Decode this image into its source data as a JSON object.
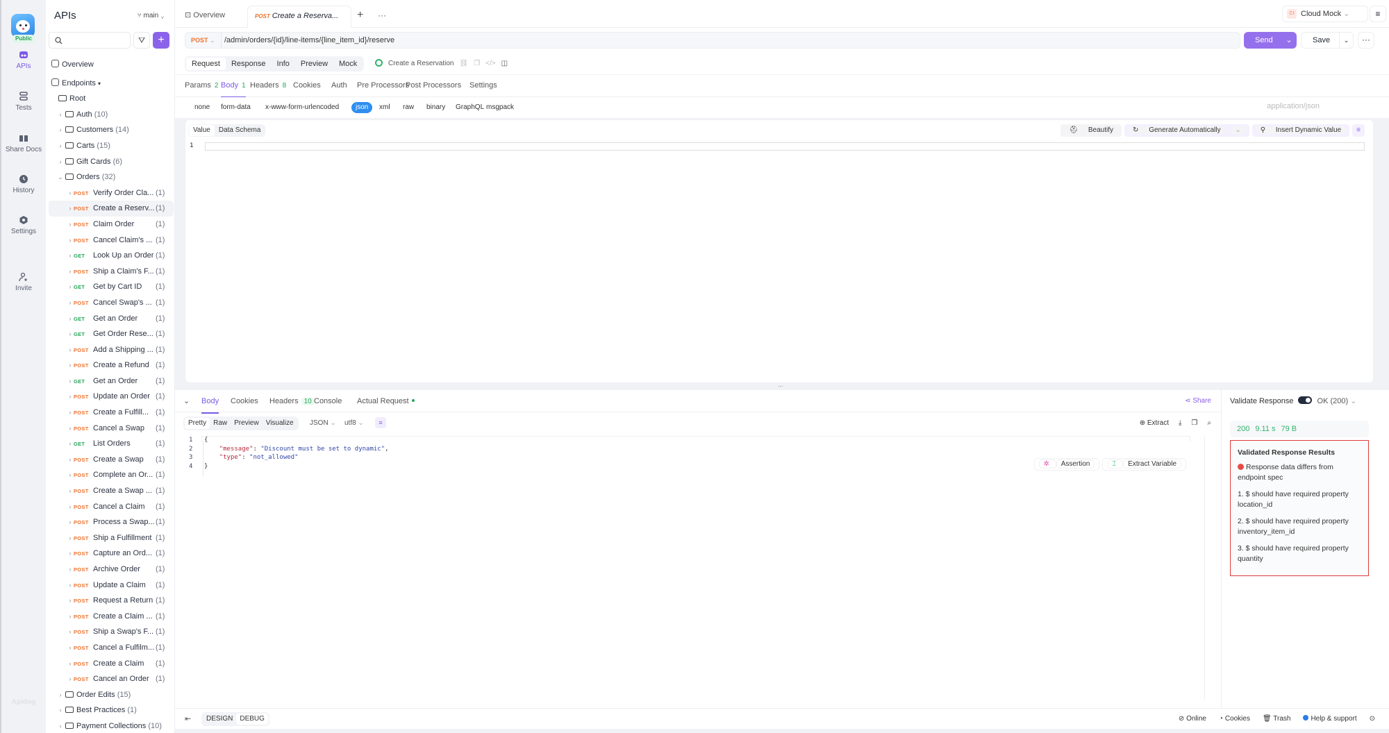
{
  "rail": {
    "badge": "Public",
    "items": [
      {
        "label": "APIs",
        "icon": "apis-icon",
        "active": true
      },
      {
        "label": "Tests",
        "icon": "tests-icon"
      },
      {
        "label": "Share Docs",
        "icon": "book-icon"
      },
      {
        "label": "History",
        "icon": "clock-icon"
      },
      {
        "label": "Settings",
        "icon": "gear-icon"
      },
      {
        "label": "Invite",
        "icon": "user-plus-icon"
      }
    ],
    "brand": "Apidog"
  },
  "sidebar": {
    "title": "APIs",
    "branch": "main",
    "search_placeholder": "",
    "overview": "Overview",
    "endpoints": "Endpoints",
    "root": "Root",
    "folders_top": [
      {
        "name": "Auth",
        "count": "(10)"
      },
      {
        "name": "Customers",
        "count": "(14)"
      },
      {
        "name": "Carts",
        "count": "(15)"
      },
      {
        "name": "Gift Cards",
        "count": "(6)"
      }
    ],
    "orders": {
      "name": "Orders",
      "count": "(32)"
    },
    "requests": [
      {
        "method": "POST",
        "name": "Verify Order Cla...",
        "count": "(1)"
      },
      {
        "method": "POST",
        "name": "Create a Reserv...",
        "count": "(1)",
        "selected": true
      },
      {
        "method": "POST",
        "name": "Claim Order",
        "count": "(1)"
      },
      {
        "method": "POST",
        "name": "Cancel Claim's ...",
        "count": "(1)"
      },
      {
        "method": "GET",
        "name": "Look Up an Order",
        "count": "(1)"
      },
      {
        "method": "POST",
        "name": "Ship a Claim's F...",
        "count": "(1)"
      },
      {
        "method": "GET",
        "name": "Get by Cart ID",
        "count": "(1)"
      },
      {
        "method": "POST",
        "name": "Cancel Swap's ...",
        "count": "(1)"
      },
      {
        "method": "GET",
        "name": "Get an Order",
        "count": "(1)"
      },
      {
        "method": "GET",
        "name": "Get Order Rese...",
        "count": "(1)"
      },
      {
        "method": "POST",
        "name": "Add a Shipping ...",
        "count": "(1)"
      },
      {
        "method": "POST",
        "name": "Create a Refund",
        "count": "(1)"
      },
      {
        "method": "GET",
        "name": "Get an Order",
        "count": "(1)"
      },
      {
        "method": "POST",
        "name": "Update an Order",
        "count": "(1)"
      },
      {
        "method": "POST",
        "name": "Create a Fulfill...",
        "count": "(1)"
      },
      {
        "method": "POST",
        "name": "Cancel a Swap",
        "count": "(1)"
      },
      {
        "method": "GET",
        "name": "List Orders",
        "count": "(1)"
      },
      {
        "method": "POST",
        "name": "Create a Swap",
        "count": "(1)"
      },
      {
        "method": "POST",
        "name": "Complete an Or...",
        "count": "(1)"
      },
      {
        "method": "POST",
        "name": "Create a Swap ...",
        "count": "(1)"
      },
      {
        "method": "POST",
        "name": "Cancel a Claim",
        "count": "(1)"
      },
      {
        "method": "POST",
        "name": "Process a Swap...",
        "count": "(1)"
      },
      {
        "method": "POST",
        "name": "Ship a Fulfillment",
        "count": "(1)"
      },
      {
        "method": "POST",
        "name": "Capture an Ord...",
        "count": "(1)"
      },
      {
        "method": "POST",
        "name": "Archive Order",
        "count": "(1)"
      },
      {
        "method": "POST",
        "name": "Update a Claim",
        "count": "(1)"
      },
      {
        "method": "POST",
        "name": "Request a Return",
        "count": "(1)"
      },
      {
        "method": "POST",
        "name": "Create a Claim ...",
        "count": "(1)"
      },
      {
        "method": "POST",
        "name": "Ship a Swap's F...",
        "count": "(1)"
      },
      {
        "method": "POST",
        "name": "Cancel a Fulfilm...",
        "count": "(1)"
      },
      {
        "method": "POST",
        "name": "Create a Claim",
        "count": "(1)"
      },
      {
        "method": "POST",
        "name": "Cancel an Order",
        "count": "(1)"
      }
    ],
    "folders_bottom": [
      {
        "name": "Order Edits",
        "count": "(15)"
      },
      {
        "name": "Best Practices",
        "count": "(1)"
      },
      {
        "name": "Payment Collections",
        "count": "(10)"
      }
    ]
  },
  "tabs": {
    "overview": "Overview",
    "active_method": "POST",
    "active_title": "Create a Reserva...",
    "add": "+",
    "more": "···"
  },
  "environment": {
    "badge": "CI",
    "label": "Cloud Mock"
  },
  "request": {
    "method": "POST",
    "url": "/admin/orders/{id}/line-items/{line_item_id}/reserve",
    "send": "Send",
    "save": "Save",
    "modes": [
      "Request",
      "Response",
      "Info",
      "Preview",
      "Mock"
    ],
    "active_mode": "Request",
    "endpoint_name": "Create a Reservation",
    "subtabs": [
      {
        "label": "Params",
        "count": "2"
      },
      {
        "label": "Body",
        "count": "1",
        "active": true
      },
      {
        "label": "Headers",
        "count": "8"
      },
      {
        "label": "Cookies"
      },
      {
        "label": "Auth"
      },
      {
        "label": "Pre Processors"
      },
      {
        "label": "Post Processors"
      },
      {
        "label": "Settings"
      }
    ],
    "body_types": [
      "none",
      "form-data",
      "x-www-form-urlencoded",
      "json",
      "xml",
      "raw",
      "binary",
      "GraphQL",
      "msgpack"
    ],
    "active_body_type": "json",
    "content_type": "application/json",
    "editor_tabs": [
      "Value",
      "Data Schema"
    ],
    "editor_tools": {
      "beautify": "Beautify",
      "generate": "Generate Automatically",
      "insert": "Insert Dynamic Value"
    },
    "line_number": "1"
  },
  "response": {
    "tabs": [
      {
        "label": "Body",
        "active": true
      },
      {
        "label": "Cookies"
      },
      {
        "label": "Headers",
        "count": "10"
      },
      {
        "label": "Console"
      },
      {
        "label": "Actual Request",
        "dot": true
      }
    ],
    "share": "Share",
    "views": [
      "Pretty",
      "Raw",
      "Preview",
      "Visualize"
    ],
    "active_view": "Pretty",
    "format": "JSON",
    "encoding": "utf8",
    "extract": "Extract",
    "code_lines": [
      {
        "n": "1",
        "text": "{"
      },
      {
        "n": "2",
        "key": "\"message\"",
        "value": "\"Discount must be set to dynamic\"",
        "trail": ","
      },
      {
        "n": "3",
        "key": "\"type\"",
        "value": "\"not_allowed\"",
        "trail": ""
      },
      {
        "n": "4",
        "text": "}"
      }
    ],
    "assertion": "Assertion",
    "extract_variable": "Extract Variable"
  },
  "validation": {
    "label": "Validate Response",
    "enabled": true,
    "status_option": "OK (200)",
    "status_code": "200",
    "time": "9.11 s",
    "size": "79 B",
    "results_title": "Validated Response Results",
    "summary": "Response data differs from endpoint spec",
    "errors": [
      "1. $ should have required property location_id",
      "2. $ should have required property inventory_item_id",
      "3. $ should have required property quantity"
    ]
  },
  "footer": {
    "modes": [
      "DESIGN",
      "DEBUG"
    ],
    "active_mode": "DEBUG",
    "online": "Online",
    "cookies": "Cookies",
    "trash": "Trash",
    "help": "Help & support"
  }
}
